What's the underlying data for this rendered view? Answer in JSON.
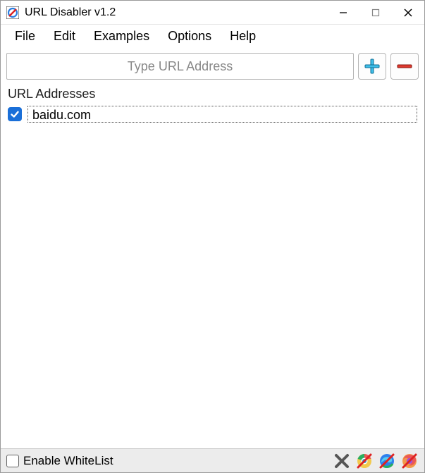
{
  "titlebar": {
    "title": "URL Disabler v1.2"
  },
  "menu": {
    "file": "File",
    "edit": "Edit",
    "examples": "Examples",
    "options": "Options",
    "help": "Help"
  },
  "toolbar": {
    "url_placeholder": "Type URL Address"
  },
  "section": {
    "url_addresses_label": "URL Addresses"
  },
  "list": {
    "items": [
      {
        "checked": true,
        "url": "baidu.com"
      }
    ]
  },
  "statusbar": {
    "whitelist_label": "Enable WhiteList",
    "whitelist_checked": false
  }
}
